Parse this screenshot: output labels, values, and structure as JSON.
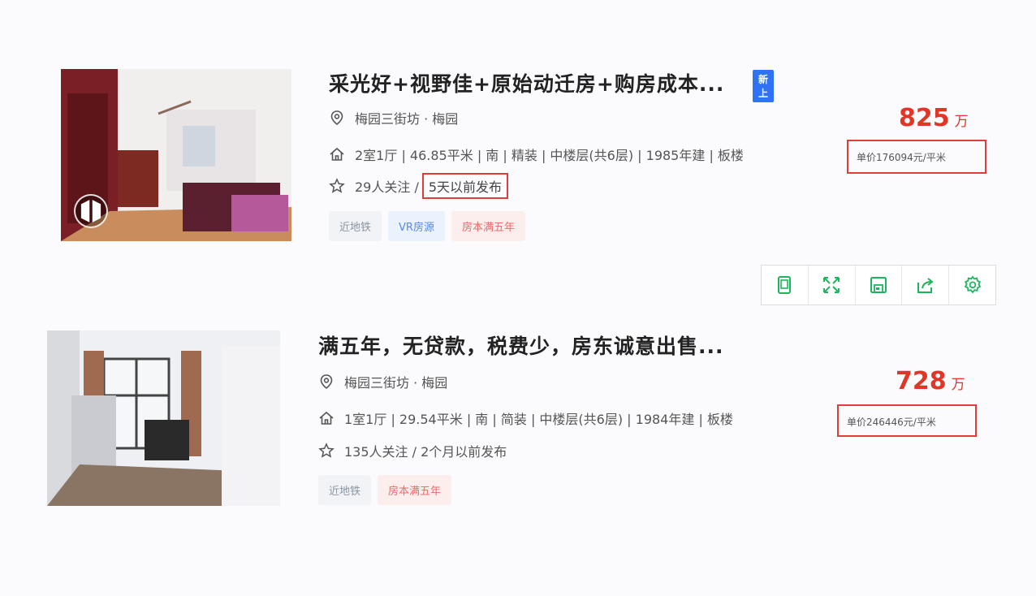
{
  "listings": [
    {
      "title": "采光好+视野佳+原始动迁房+购房成本...",
      "new_tag": "新上",
      "location": "梅园三街坊 · 梅园",
      "specs": "2室1厅 | 46.85平米 | 南 | 精装 | 中楼层(共6层) | 1985年建 | 板楼",
      "follow_prefix": "29人关注 /",
      "publish": "5天以前发布",
      "tags": [
        "近地铁",
        "VR房源",
        "房本满五年"
      ],
      "price": "825",
      "price_unit": "万",
      "unit_price": "单价176094元/平米"
    },
    {
      "title": "满五年，无贷款，税费少，房东诚意出售...",
      "location": "梅园三街坊 · 梅园",
      "specs": "1室1厅 | 29.54平米 | 南 | 简装 | 中楼层(共6层) | 1984年建 | 板楼",
      "follow_text": "135人关注 / 2个月以前发布",
      "tags": [
        "近地铁",
        "房本满五年"
      ],
      "price": "728",
      "price_unit": "万",
      "unit_price": "单价246446元/平米"
    }
  ],
  "toolbar": {
    "tools": [
      "tablet-icon",
      "expand-icon",
      "save-icon",
      "share-icon",
      "settings-icon"
    ],
    "color": "#1bb55c"
  },
  "colors": {
    "price": "#e03628",
    "highlight_box": "#e23b3b",
    "new_tag": "#3072f6"
  }
}
